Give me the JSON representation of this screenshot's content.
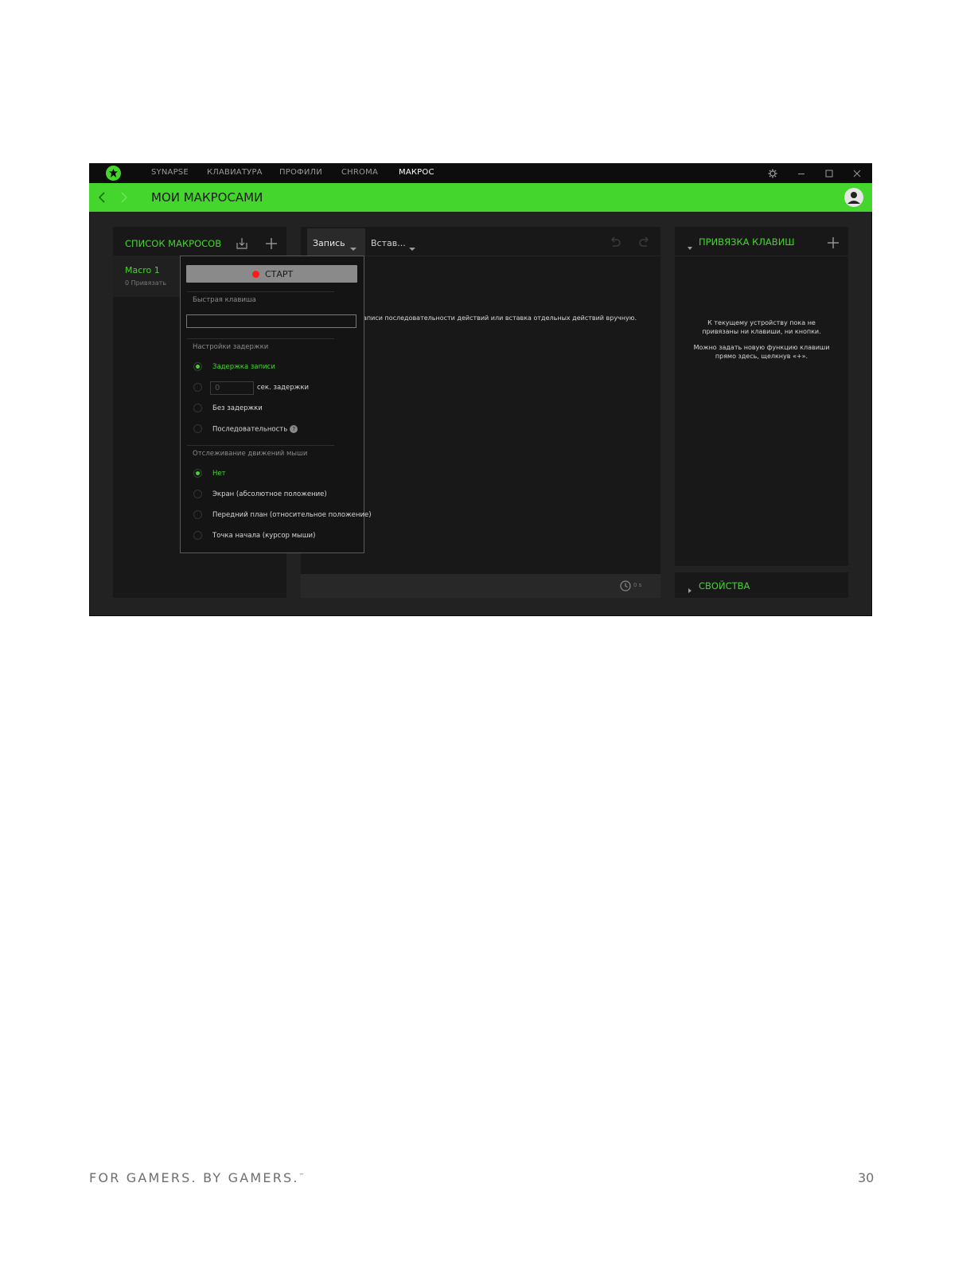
{
  "nav": {
    "tabs": [
      {
        "label": "SYNAPSE"
      },
      {
        "label": "КЛАВИАТУРА"
      },
      {
        "label": "ПРОФИЛИ"
      },
      {
        "label": "CHROMA"
      },
      {
        "label": "МАКРОС"
      }
    ],
    "active_tab": "МАКРОС"
  },
  "header": {
    "title": "МОИ МАКРОСАМИ"
  },
  "macro_list": {
    "title": "СПИСОК МАКРОСОВ",
    "items": [
      {
        "name": "Macro 1",
        "sub": "0 Привязать"
      }
    ]
  },
  "editor": {
    "record_tab": "Запись",
    "insert_tab": "Встав...",
    "hint": "аписи последовательности действий или вставка отдельных действий вручную.",
    "duration": "0 s"
  },
  "record_popup": {
    "start_label": "СТАРТ",
    "hotkey_label": "Быстрая клавиша",
    "hotkey_value": "",
    "delay_section": "Настройки задержки",
    "delay_options": [
      "Задержка записи",
      "сек. задержки",
      "Без задержки",
      "Последовательность"
    ],
    "delay_selected": 0,
    "delay_seconds_placeholder": "0",
    "mouse_section": "Отслеживание движений мыши",
    "mouse_options": [
      "Нет",
      "Экран (абсолютное положение)",
      "Передний план (относительное положение)",
      "Точка начала (курсор мыши)"
    ],
    "mouse_selected": 0
  },
  "binding_panel": {
    "title": "ПРИВЯЗКА КЛАВИШ",
    "empty_line1": "К текущему устройству пока не привязаны ни клавиши, ни кнопки.",
    "empty_line2": "Можно задать новую функцию клавиши прямо здесь, щелкнув «+»."
  },
  "properties_panel": {
    "title": "СВОЙСТВА"
  },
  "footer": {
    "tagline": "FOR GAMERS. BY GAMERS.",
    "trademark": "™",
    "page_number": "30"
  },
  "colors": {
    "accent": "#44d62c",
    "record": "#ff1a1a",
    "background": "#222222"
  },
  "icons": [
    "razer-logo-icon",
    "gear-icon",
    "minimize-icon",
    "maximize-icon",
    "close-icon",
    "back-arrow-icon",
    "forward-arrow-icon",
    "user-avatar-icon",
    "import-icon",
    "add-icon",
    "undo-icon",
    "redo-icon",
    "chevron-down-icon",
    "clock-icon",
    "triangle-down-icon",
    "triangle-right-icon",
    "help-icon"
  ]
}
